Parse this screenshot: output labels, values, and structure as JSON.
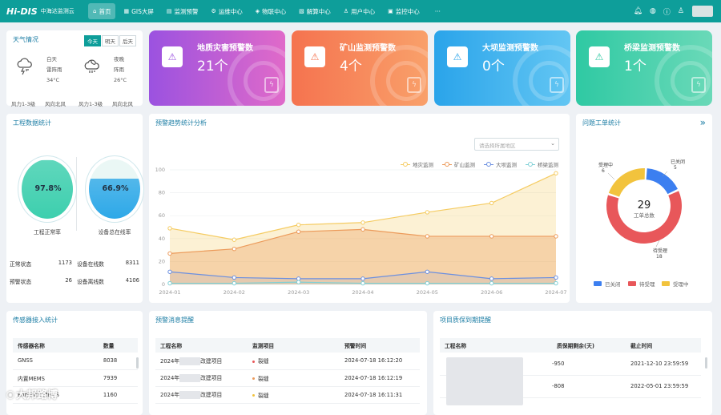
{
  "header": {
    "logo_mark": "Hi-DIS",
    "logo_name": "中海达监测云",
    "nav": [
      {
        "label": "首页",
        "icon": "⌂",
        "active": true
      },
      {
        "label": "GIS大屏",
        "icon": "▦"
      },
      {
        "label": "监测预警",
        "icon": "▤"
      },
      {
        "label": "运维中心",
        "icon": "⚙"
      },
      {
        "label": "物联中心",
        "icon": "◈"
      },
      {
        "label": "解算中心",
        "icon": "▧"
      },
      {
        "label": "用户中心",
        "icon": "♙"
      },
      {
        "label": "监控中心",
        "icon": "▣"
      },
      {
        "label": "···",
        "icon": ""
      }
    ]
  },
  "weather": {
    "title": "天气情况",
    "tabs": [
      "今天",
      "明天",
      "后天"
    ],
    "day": {
      "period": "白天",
      "desc": "雷阵雨",
      "temp": "34°C",
      "wind_level": "风力1-3级",
      "wind_dir": "风向北风"
    },
    "night": {
      "period": "夜晚",
      "desc": "阵雨",
      "temp": "26°C",
      "wind_level": "风力1-3级",
      "wind_dir": "风向北风"
    }
  },
  "alerts": [
    {
      "title": "地质灾害预警数",
      "count": "21个",
      "color1": "#9b52e0",
      "color2": "#e06ac9",
      "icon": "⚠",
      "icon_color": "#9b52e0"
    },
    {
      "title": "矿山监测预警数",
      "count": "4个",
      "color1": "#f5734f",
      "color2": "#f9a06a",
      "icon": "⚠",
      "icon_color": "#f5734f"
    },
    {
      "title": "大坝监测预警数",
      "count": "0个",
      "color1": "#2aa4ea",
      "color2": "#63c6f3",
      "icon": "⚠",
      "icon_color": "#2aa4ea"
    },
    {
      "title": "桥梁监测预警数",
      "count": "1个",
      "color1": "#2fc9a3",
      "color2": "#6ad9b8",
      "icon": "⚠",
      "icon_color": "#2fc9a3"
    }
  ],
  "engineering": {
    "title": "工程数据统计",
    "gauges": [
      {
        "value": "97.8%",
        "fill": 0.978,
        "label": "工程正常率",
        "color": "#3dcfae"
      },
      {
        "value": "66.9%",
        "fill": 0.669,
        "label": "设备总在线率",
        "color": "#2da8e8"
      }
    ],
    "stats": [
      {
        "label": "正常状态",
        "value": "1173"
      },
      {
        "label": "设备在线数",
        "value": "8311"
      },
      {
        "label": "预警状态",
        "value": "26"
      },
      {
        "label": "设备离线数",
        "value": "4106"
      }
    ]
  },
  "trend": {
    "title": "预警趋势统计分析",
    "select_placeholder": "请选择所属地区"
  },
  "chart_data": [
    {
      "type": "area",
      "title": "",
      "x": [
        "2024-01",
        "2024-02",
        "2024-03",
        "2024-04",
        "2024-05",
        "2024-06",
        "2024-07"
      ],
      "ylim": [
        0,
        100
      ],
      "yticks": [
        "0",
        "20",
        "40",
        "60",
        "80",
        "100"
      ],
      "legend_position": "top-right",
      "grid": true,
      "series": [
        {
          "name": "地灾监测",
          "color": "#f5cc63",
          "values": [
            49,
            39,
            52,
            54,
            63,
            71,
            97
          ]
        },
        {
          "name": "矿山监测",
          "color": "#ec9a5a",
          "values": [
            27,
            31,
            46,
            48,
            42,
            42,
            42
          ]
        },
        {
          "name": "大坝监测",
          "color": "#6b8fe0",
          "values": [
            11,
            6,
            5,
            5,
            11,
            5,
            6
          ]
        },
        {
          "name": "桥梁监测",
          "color": "#7fd0d6",
          "values": [
            1,
            1,
            2,
            1,
            1,
            1,
            1
          ]
        }
      ]
    },
    {
      "type": "pie",
      "title": "",
      "center_value": "29",
      "center_label": "工单总数",
      "legend_position": "bottom",
      "series": [
        {
          "name": "已关闭",
          "color": "#3c7ff0",
          "value": 5
        },
        {
          "name": "待受理",
          "color": "#e8575a",
          "value": 18
        },
        {
          "name": "受理中",
          "color": "#f2c33d",
          "value": 6
        }
      ]
    }
  ],
  "issues": {
    "title": "问题工单统计",
    "more_icon": "»",
    "labels": [
      {
        "text": "已关闭",
        "num": "5"
      },
      {
        "text": "待受理",
        "num": "18"
      },
      {
        "text": "受理中",
        "num": "6"
      }
    ]
  },
  "sensors": {
    "title": "传感器接入统计",
    "headers": [
      "传感器名称",
      "数量"
    ],
    "rows": [
      {
        "name": "GNSS",
        "count": "8038"
      },
      {
        "name": "内置MEMS",
        "count": "7939"
      },
      {
        "name": "Enhance MEMS",
        "count": "1160"
      }
    ]
  },
  "warnings": {
    "title": "预警消息提醒",
    "headers": [
      "工程名称",
      "监测项目",
      "预警时间"
    ],
    "rows": [
      {
        "name": "2024年",
        "suffix": "改建项目",
        "item": "裂缝",
        "time": "2024-07-18 16:12:20",
        "color": "#e8575a"
      },
      {
        "name": "2024年",
        "suffix": "改建项目",
        "item": "裂缝",
        "time": "2024-07-18 16:12:19",
        "color": "#ec9a5a"
      },
      {
        "name": "2024年",
        "suffix": "改建项目",
        "item": "裂缝",
        "time": "2024-07-18 16:11:31",
        "color": "#f2c33d"
      }
    ]
  },
  "warranty": {
    "title": "项目质保到期提醒",
    "headers": [
      "工程名称",
      "质保期剩余(天)",
      "截止时间"
    ],
    "rows": [
      {
        "remain": "-950",
        "deadline": "2021-12-10 23:59:59"
      },
      {
        "remain": "-808",
        "deadline": "2022-05-01 23:59:59"
      }
    ]
  },
  "watermark": "大邦路博"
}
